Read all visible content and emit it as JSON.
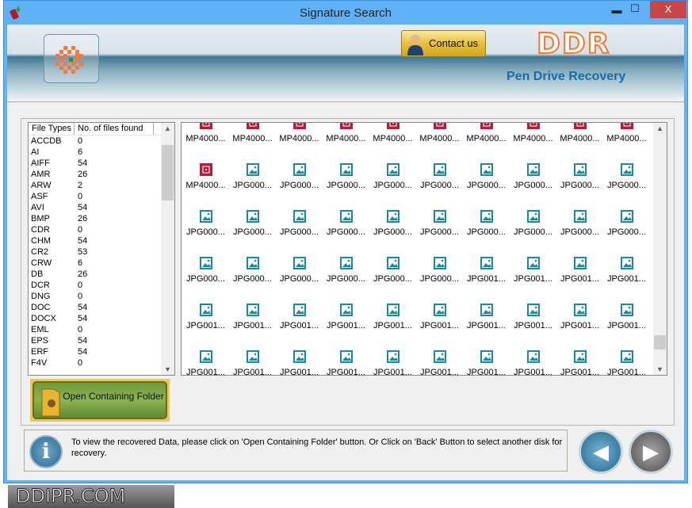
{
  "window": {
    "title": "Signature Search",
    "minimize": "▬",
    "maximize": "☐",
    "close": "X"
  },
  "header": {
    "contact_label": "Contact us",
    "brand": "DDR",
    "tagline": "Pen Drive Recovery"
  },
  "file_types": {
    "columns": [
      "File Types",
      "No. of files found"
    ],
    "rows": [
      [
        "ACCDB",
        "0"
      ],
      [
        "AI",
        "6"
      ],
      [
        "AIFF",
        "54"
      ],
      [
        "AMR",
        "26"
      ],
      [
        "ARW",
        "2"
      ],
      [
        "ASF",
        "0"
      ],
      [
        "AVI",
        "54"
      ],
      [
        "BMP",
        "26"
      ],
      [
        "CDR",
        "0"
      ],
      [
        "CHM",
        "54"
      ],
      [
        "CR2",
        "53"
      ],
      [
        "CRW",
        "6"
      ],
      [
        "DB",
        "26"
      ],
      [
        "DCR",
        "0"
      ],
      [
        "DNG",
        "0"
      ],
      [
        "DOC",
        "54"
      ],
      [
        "DOCX",
        "54"
      ],
      [
        "EML",
        "0"
      ],
      [
        "EPS",
        "54"
      ],
      [
        "ERF",
        "54"
      ],
      [
        "F4V",
        "0"
      ]
    ]
  },
  "files": {
    "rows": [
      [
        "MP4000...",
        "MP4000...",
        "MP4000...",
        "MP4000...",
        "MP4000...",
        "MP4000...",
        "MP4000...",
        "MP4000...",
        "MP4000...",
        "MP4000..."
      ],
      [
        "MP4000...",
        "JPG000...",
        "JPG000...",
        "JPG000...",
        "JPG000...",
        "JPG000...",
        "JPG000...",
        "JPG000...",
        "JPG000...",
        "JPG000..."
      ],
      [
        "JPG000...",
        "JPG000...",
        "JPG000...",
        "JPG000...",
        "JPG000...",
        "JPG000...",
        "JPG000...",
        "JPG000...",
        "JPG000...",
        "JPG000..."
      ],
      [
        "JPG000...",
        "JPG000...",
        "JPG000...",
        "JPG000...",
        "JPG000...",
        "JPG000...",
        "JPG001...",
        "JPG001...",
        "JPG001...",
        "JPG001..."
      ],
      [
        "JPG001...",
        "JPG001...",
        "JPG001...",
        "JPG001...",
        "JPG001...",
        "JPG001...",
        "JPG001...",
        "JPG001...",
        "JPG001...",
        "JPG001..."
      ],
      [
        "JPG001...",
        "JPG001...",
        "JPG001...",
        "JPG001...",
        "JPG001...",
        "JPG001...",
        "JPG001...",
        "JPG001...",
        "JPG001...",
        "JPG001..."
      ]
    ],
    "colors": {
      "video": "#b0203c",
      "image": "#1a8a9a"
    }
  },
  "open_folder_label": "Open Containing Folder",
  "status_message": "To view the recovered Data, please click on 'Open Containing Folder' button. Or Click on 'Back' Button to select another disk for recovery.",
  "watermark": "DDIPR.COM"
}
